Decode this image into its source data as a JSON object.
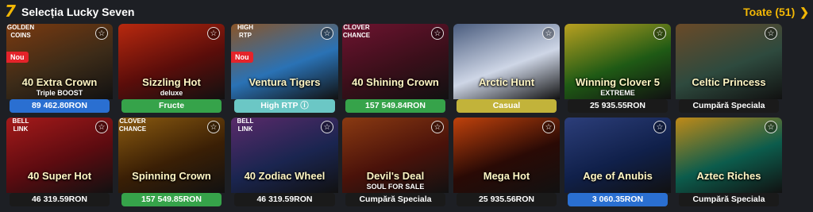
{
  "header": {
    "logo_glyph": "7",
    "title": "Selecția Lucky Seven",
    "see_all": "Toate (51)",
    "chevron": "❯"
  },
  "icons": {
    "favorite": "star-outline-icon",
    "rtp": "info-icon"
  },
  "rows": [
    [
      {
        "name": "40 Extra Crown",
        "sub": "Triple BOOST",
        "tag": "89 462.80RON",
        "tag_color": "#2a6fd1",
        "bg": "#3c2b18",
        "bg2": "#7b3a10",
        "new": "Nou",
        "corner": "GOLDEN COINS"
      },
      {
        "name": "Sizzling Hot",
        "sub": "deluxe",
        "tag": "Fructe",
        "tag_color": "#36a34a",
        "bg": "#5a0d0a",
        "bg2": "#b8290f",
        "new": "",
        "corner": ""
      },
      {
        "name": "Ventura Tigers",
        "sub": "",
        "tag": "High RTP ⓘ",
        "tag_color": "#6bc7c5",
        "bg": "#2a72b5",
        "bg2": "#8a5528",
        "new": "Nou",
        "corner": "HIGH RTP"
      },
      {
        "name": "40 Shining Crown",
        "sub": "",
        "tag": "157 549.84RON",
        "tag_color": "#36a34a",
        "bg": "#3a0f1a",
        "bg2": "#6e1330",
        "new": "",
        "corner": "CLOVER CHANCE"
      },
      {
        "name": "Arctic Hunt",
        "sub": "",
        "tag": "Casual",
        "tag_color": "#c2b33a",
        "bg": "#ced6e6",
        "bg2": "#4a5c7e",
        "new": "",
        "corner": ""
      },
      {
        "name": "Winning Clover 5",
        "sub": "EXTREME",
        "tag": "25 935.55RON",
        "tag_color": "#1a1a1a",
        "bg": "#1f5a15",
        "bg2": "#b9a020",
        "new": "",
        "corner": ""
      },
      {
        "name": "Celtic Princess",
        "sub": "",
        "tag": "Cumpără Speciala",
        "tag_color": "#1a1a1a",
        "bg": "#2e4a3e",
        "bg2": "#6a4a28",
        "new": "",
        "corner": ""
      }
    ],
    [
      {
        "name": "40 Super Hot",
        "sub": "",
        "tag": "46 319.59RON",
        "tag_color": "#1a1a1a",
        "bg": "#5c0b10",
        "bg2": "#a51a1a",
        "new": "",
        "corner": "BELL LINK"
      },
      {
        "name": "Spinning Crown",
        "sub": "",
        "tag": "157 549.85RON",
        "tag_color": "#36a34a",
        "bg": "#3a1f05",
        "bg2": "#8a5a10",
        "new": "",
        "corner": "CLOVER CHANCE"
      },
      {
        "name": "40 Zodiac Wheel",
        "sub": "",
        "tag": "46 319.59RON",
        "tag_color": "#1a1a1a",
        "bg": "#1a2550",
        "bg2": "#5a2a6a",
        "new": "",
        "corner": "BELL LINK"
      },
      {
        "name": "Devil's Deal",
        "sub": "SOUL FOR SALE",
        "tag": "Cumpără Speciala",
        "tag_color": "#1a1a1a",
        "bg": "#4a120a",
        "bg2": "#8a3a12",
        "new": "",
        "corner": ""
      },
      {
        "name": "Mega Hot",
        "sub": "",
        "tag": "25 935.56RON",
        "tag_color": "#1a1a1a",
        "bg": "#2a0a05",
        "bg2": "#c0420c",
        "new": "",
        "corner": ""
      },
      {
        "name": "Age of Anubis",
        "sub": "",
        "tag": "3 060.35RON",
        "tag_color": "#2a6fd1",
        "bg": "#10204a",
        "bg2": "#2c3e7a",
        "new": "",
        "corner": ""
      },
      {
        "name": "Aztec Riches",
        "sub": "",
        "tag": "Cumpără Speciala",
        "tag_color": "#1a1a1a",
        "bg": "#0c5c4c",
        "bg2": "#c08a18",
        "new": "",
        "corner": ""
      }
    ]
  ]
}
